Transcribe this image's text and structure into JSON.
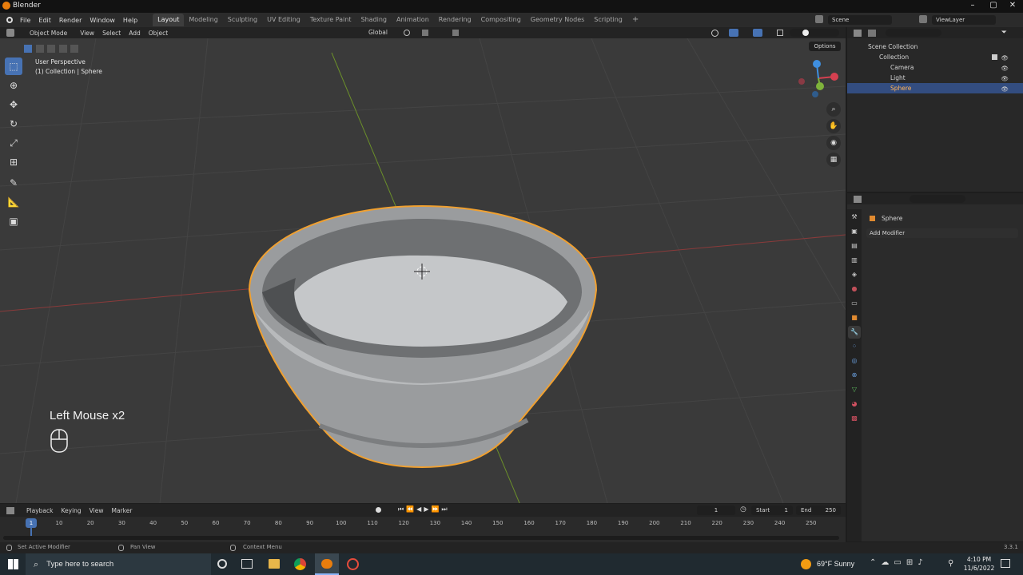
{
  "window": {
    "title": "Blender",
    "controls": [
      "–",
      "▢",
      "✕"
    ]
  },
  "menu": {
    "items": [
      "File",
      "Edit",
      "Render",
      "Window",
      "Help"
    ]
  },
  "workspaces": {
    "tabs": [
      "Layout",
      "Modeling",
      "Sculpting",
      "UV Editing",
      "Texture Paint",
      "Shading",
      "Animation",
      "Rendering",
      "Compositing",
      "Geometry Nodes",
      "Scripting"
    ],
    "active": "Layout",
    "add": "+"
  },
  "scene": {
    "name": "Scene",
    "view_layer": "ViewLayer"
  },
  "viewport_header": {
    "mode": "Object Mode",
    "menus": [
      "View",
      "Select",
      "Add",
      "Object"
    ],
    "orientation": "Global",
    "options_label": "Options"
  },
  "viewport": {
    "view_name": "User Perspective",
    "context": "(1) Collection | Sphere",
    "key_hint": "Left Mouse x2",
    "gizmo_axes": {
      "x": "X",
      "y": "Y",
      "z": "Z"
    },
    "accent": "#ffa033"
  },
  "tools": [
    "select-box",
    "cursor",
    "move",
    "rotate",
    "scale",
    "transform",
    "annotate",
    "measure",
    "add-cube"
  ],
  "outliner": {
    "root": "Scene Collection",
    "collection": "Collection",
    "objects": [
      {
        "name": "Camera",
        "selected": false,
        "color": "#e0a040"
      },
      {
        "name": "Light",
        "selected": false,
        "color": "#e0a040"
      },
      {
        "name": "Sphere",
        "selected": true,
        "color": "#e0a040"
      }
    ]
  },
  "properties": {
    "object_name": "Sphere",
    "add_modifier": "Add Modifier"
  },
  "timeline": {
    "menus": [
      "Playback",
      "Keying",
      "View",
      "Marker"
    ],
    "current_frame": "1",
    "start_label": "Start",
    "start_value": "1",
    "end_label": "End",
    "end_value": "250",
    "ticks": [
      "10",
      "20",
      "30",
      "40",
      "50",
      "60",
      "70",
      "80",
      "90",
      "100",
      "110",
      "120",
      "130",
      "140",
      "150",
      "160",
      "170",
      "180",
      "190",
      "200",
      "210",
      "220",
      "230",
      "240",
      "250"
    ],
    "playhead": "1"
  },
  "status": {
    "left": "Set Active Modifier",
    "middle": "Pan View",
    "right": "Context Menu",
    "version": "3.3.1"
  },
  "taskbar": {
    "search_placeholder": "Type here to search",
    "weather": "69°F  Sunny",
    "time": "4:10 PM",
    "date": "11/6/2022"
  }
}
